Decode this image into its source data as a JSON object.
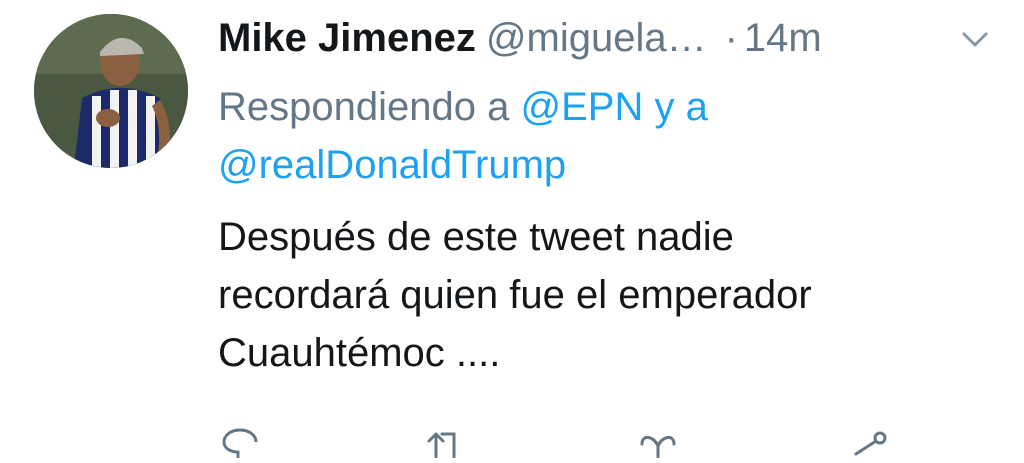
{
  "tweet": {
    "author_name": "Mike Jimenez",
    "author_handle": "@miguela…",
    "separator": "·",
    "time": "14m",
    "reply_prefix": "Respondiendo a",
    "reply_mention_1": "@EPN",
    "reply_and": "y a",
    "reply_mention_2": "@realDonaldTrump",
    "text_line_1": "Después de este tweet nadie",
    "text_line_2": "recordará quien fue el emperador",
    "text_line_3": "Cuauhtémoc ...."
  },
  "icons": {
    "menu": "chevron-down-icon",
    "reply": "reply-icon",
    "retweet": "retweet-icon",
    "like": "heart-icon",
    "share": "share-icon"
  },
  "colors": {
    "text": "#14171a",
    "secondary": "#657786",
    "link": "#1da1f2"
  }
}
